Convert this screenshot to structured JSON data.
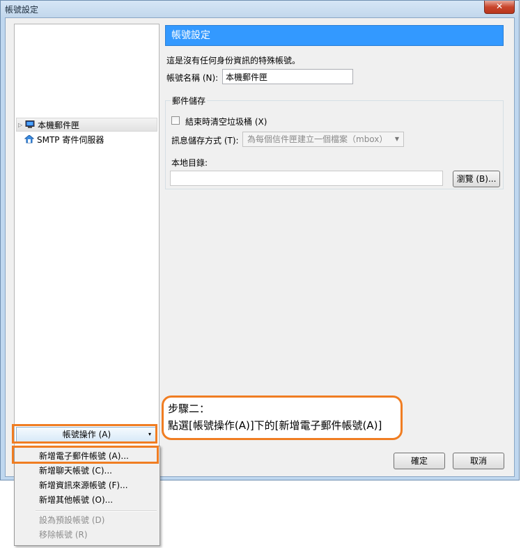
{
  "window": {
    "title": "帳號設定",
    "close_label": "✕"
  },
  "tree": {
    "items": [
      {
        "label": "本機郵件匣",
        "icon": "computer-icon"
      },
      {
        "label": "SMTP 寄件伺服器",
        "icon": "server-icon"
      }
    ],
    "action_button": "帳號操作 (A)"
  },
  "settings": {
    "header": "帳號設定",
    "description": "這是沒有任何身份資訊的特殊帳號。",
    "name_label": "帳號名稱 (N):",
    "name_value": "本機郵件匣",
    "storage": {
      "title": "郵件儲存",
      "empty_trash_label": "結束時清空垃圾桶 (X)",
      "empty_trash_checked": false,
      "store_type_label": "訊息儲存方式 (T):",
      "store_type_value": "為每個信件匣建立一個檔案（mbox）",
      "local_dir_label": "本地目錄:",
      "local_dir_value": "",
      "browse_button": "瀏覽 (B)..."
    }
  },
  "callout": {
    "line1": "步驟二：",
    "line2": "點選[帳號操作(A)]下的[新增電子郵件帳號(A)]"
  },
  "footer": {
    "ok_button": "確定",
    "cancel_button": "取消"
  },
  "menu": {
    "items": [
      {
        "label": "新增電子郵件帳號 (A)...",
        "enabled": true
      },
      {
        "label": "新增聊天帳號 (C)...",
        "enabled": true
      },
      {
        "label": "新增資訊來源帳號 (F)...",
        "enabled": true
      },
      {
        "label": "新增其他帳號 (O)...",
        "enabled": true
      },
      {
        "label": "設為預設帳號 (D)",
        "enabled": false
      },
      {
        "label": "移除帳號 (R)",
        "enabled": false
      }
    ]
  },
  "colors": {
    "header_blue": "#3399ff",
    "highlight_orange": "#f07d22"
  }
}
